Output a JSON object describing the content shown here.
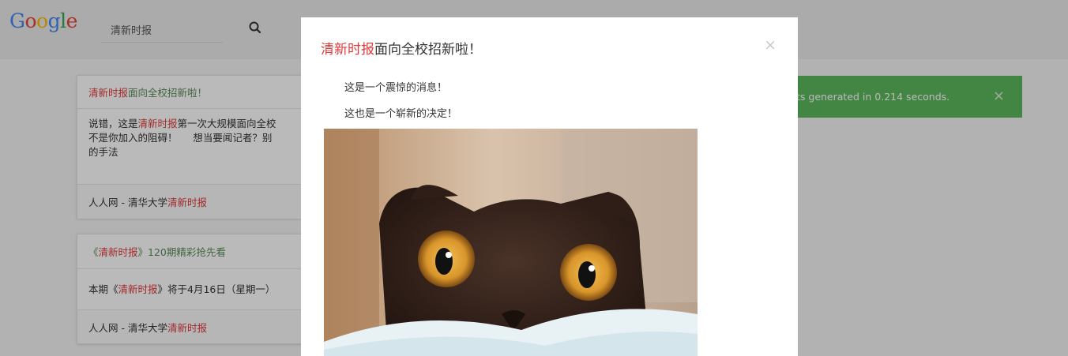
{
  "header": {
    "logo_letters": [
      "G",
      "o",
      "o",
      "g",
      "l",
      "e"
    ],
    "logo_colors": [
      "#4285f4",
      "#ea4335",
      "#fbbc05",
      "#4285f4",
      "#34a853",
      "#ea4335"
    ],
    "search_value": "清新时报",
    "search_icon": "search-icon"
  },
  "results": [
    {
      "title_hl": "清新时报",
      "title_rest": "面向全校招新啦！",
      "body_line1_a": "说错，这是",
      "body_line1_hl": "清新时报",
      "body_line1_b": "第一次大规模面向全校",
      "body_line2": "不是你加入的阻碍！     想当要闻记者？别",
      "body_line3": "的手法",
      "footer_a": "人人网 - 清华大学",
      "footer_hl": "清新时报"
    },
    {
      "title_a": "《",
      "title_hl": "清新时报",
      "title_rest": "》120期精彩抢先看",
      "body_a": "本期《",
      "body_hl": "清新时报",
      "body_b": "》将于4月16日（星期一）",
      "footer_a": "人人网 - 清华大学",
      "footer_hl": "清新时报"
    }
  ],
  "toast": {
    "text": "ts generated in 0.214 seconds.",
    "close": "×",
    "color": "#5cb85c"
  },
  "modal": {
    "title_hl": "清新时报",
    "title_rest": "面向全校招新啦！",
    "close": "×",
    "line1": "这是一个震惊的消息！",
    "line2": "这也是一个崭新的决定！",
    "highlight_color": "#e03a3a"
  }
}
